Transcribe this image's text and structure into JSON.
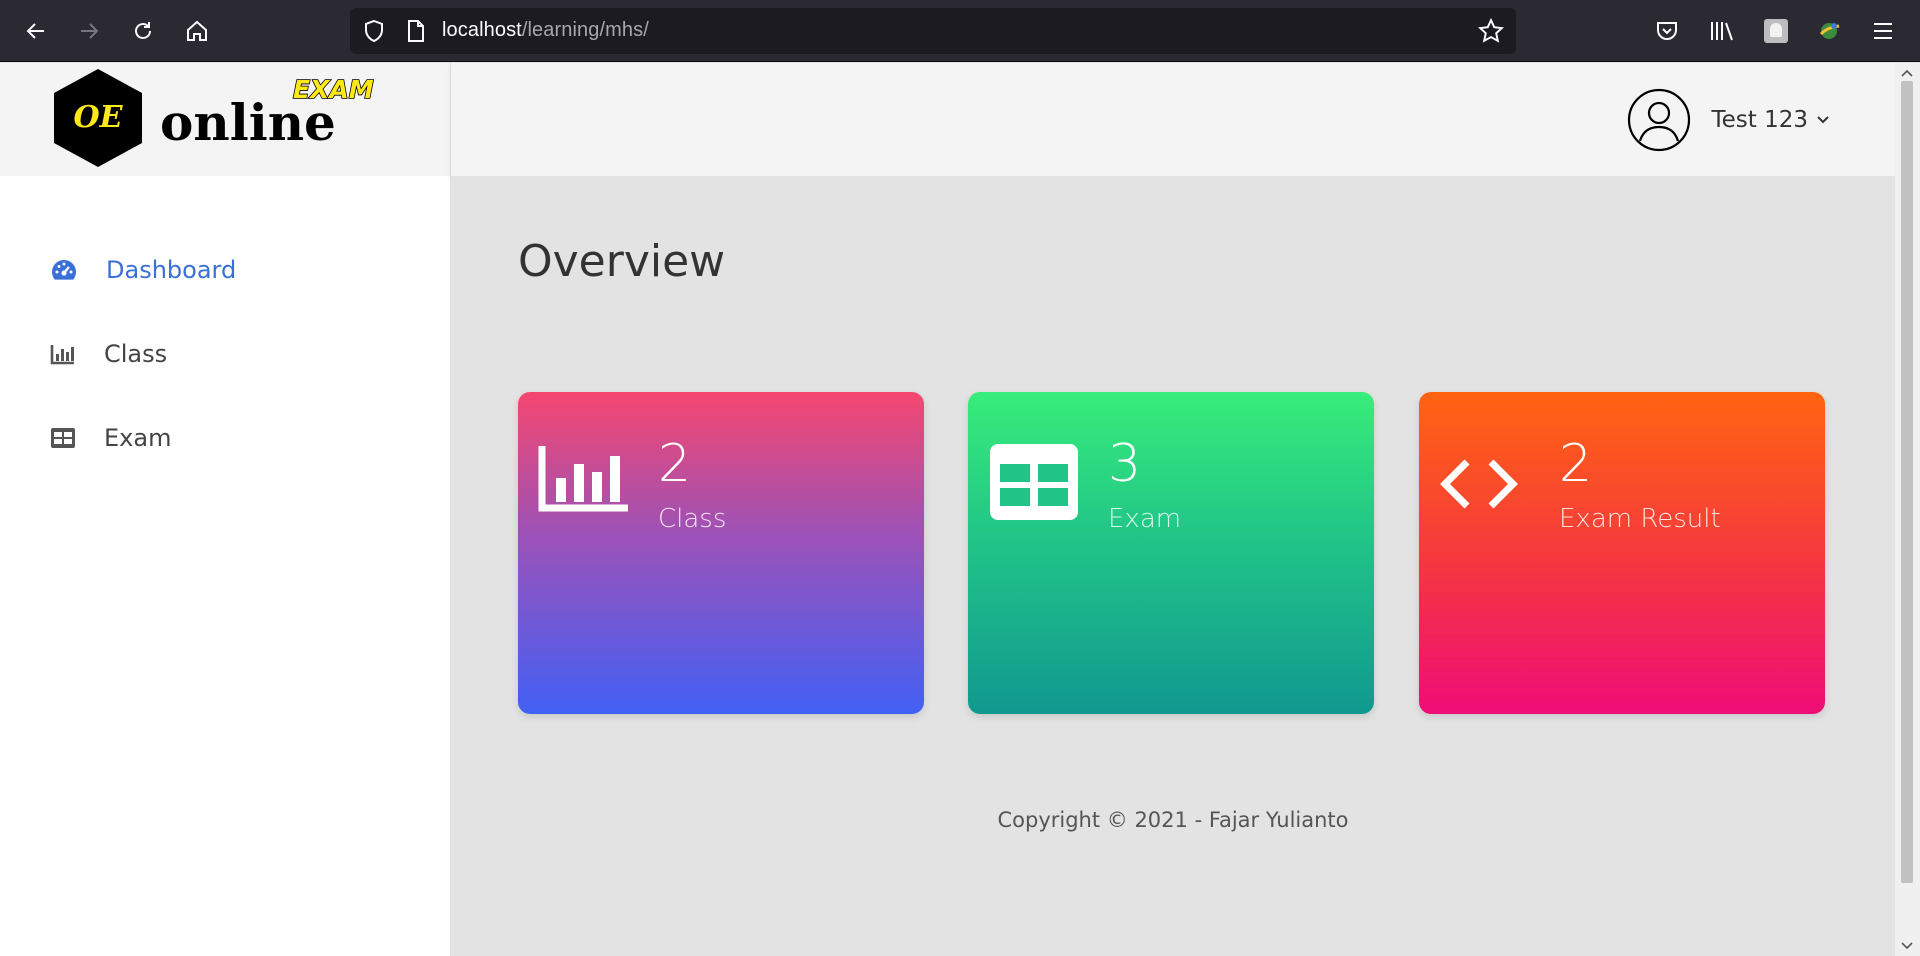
{
  "browser": {
    "url_host": "localhost",
    "url_path": "/learning/mhs/"
  },
  "logo": {
    "badge_text": "OE",
    "word": "online",
    "tag": "EXAM"
  },
  "sidebar": {
    "items": [
      {
        "label": "Dashboard",
        "icon": "dashboard-gauge-icon",
        "active": true
      },
      {
        "label": "Class",
        "icon": "bar-chart-icon",
        "active": false
      },
      {
        "label": "Exam",
        "icon": "table-icon",
        "active": false
      }
    ]
  },
  "user": {
    "name": "Test 123",
    "icon": "user-circle-icon"
  },
  "main": {
    "title": "Overview",
    "cards": [
      {
        "value": "2",
        "label": "Class",
        "icon": "bar-chart-icon",
        "gradient": [
          "#f5476f",
          "#4260f5"
        ]
      },
      {
        "value": "3",
        "label": "Exam",
        "icon": "table-icon",
        "gradient": [
          "#38ed7a",
          "#10998f"
        ]
      },
      {
        "value": "2",
        "label": "Exam Result",
        "icon": "code-icon",
        "gradient": [
          "#ff6411",
          "#ee0d77"
        ]
      }
    ],
    "footer": "Copyright © 2021 - Fajar Yulianto"
  },
  "colors": {
    "accent": "#3a6fd8",
    "chrome_bg": "#2b2a33"
  }
}
